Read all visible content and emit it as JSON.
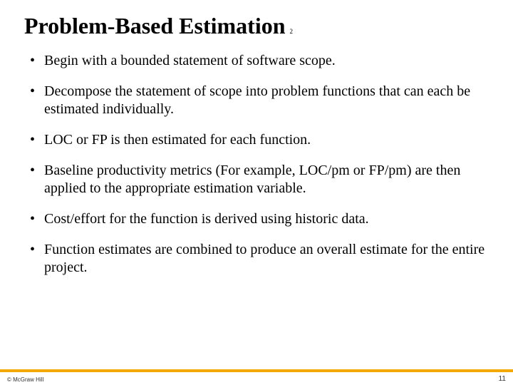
{
  "title": "Problem-Based Estimation",
  "title_sub": "2",
  "bullets": [
    "Begin with a bounded statement of software scope.",
    "Decompose the statement of scope into problem functions that can each be estimated individually.",
    "LOC or FP is then estimated for each function.",
    "Baseline productivity metrics (For example, LOC/pm or FP/pm) are then applied to the appropriate estimation variable.",
    "Cost/effort for the function is derived using historic data.",
    "Function estimates are combined to produce an overall estimate for the entire project."
  ],
  "copyright": "© McGraw Hill",
  "page_number": "11"
}
